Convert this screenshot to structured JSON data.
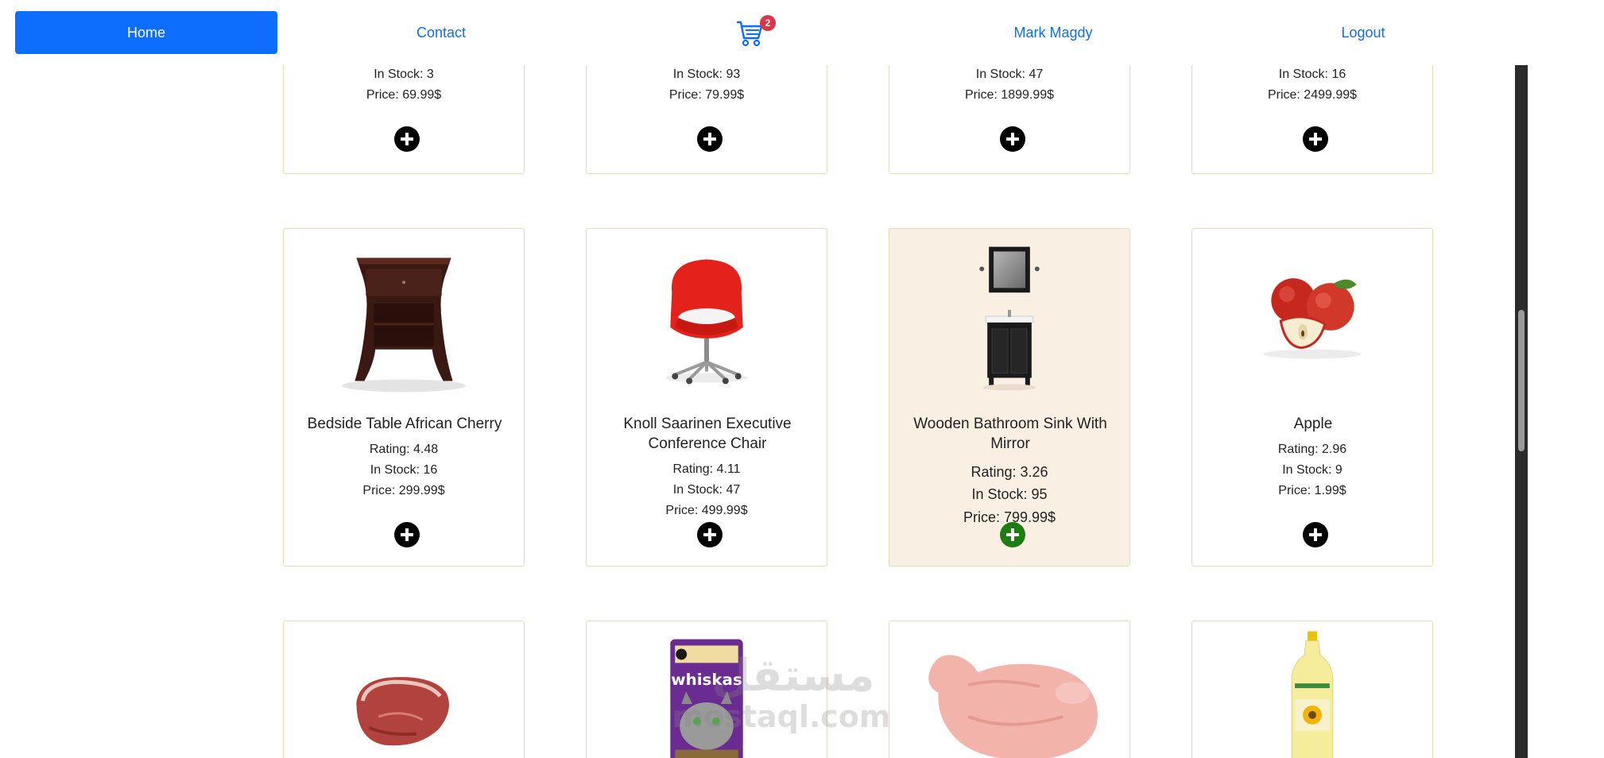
{
  "nav": {
    "home": "Home",
    "contact": "Contact",
    "cart_count": "2",
    "user": "Mark Magdy",
    "logout": "Logout"
  },
  "products_top": [
    {
      "stock": "In Stock: 3",
      "price": "Price: 69.99$"
    },
    {
      "stock": "In Stock: 93",
      "price": "Price: 79.99$"
    },
    {
      "stock": "In Stock: 47",
      "price": "Price: 1899.99$"
    },
    {
      "stock": "In Stock: 16",
      "price": "Price: 2499.99$"
    }
  ],
  "products_mid": [
    {
      "title": "Bedside Table African Cherry",
      "rating": "Rating: 4.48",
      "stock": "In Stock: 16",
      "price": "Price: 299.99$"
    },
    {
      "title": "Knoll Saarinen Executive Conference Chair",
      "rating": "Rating: 4.11",
      "stock": "In Stock: 47",
      "price": "Price: 499.99$"
    },
    {
      "title": "Wooden Bathroom Sink With Mirror",
      "rating": "Rating: 3.26",
      "stock": "In Stock: 95",
      "price": "Price: 799.99$"
    },
    {
      "title": "Apple",
      "rating": "Rating: 2.96",
      "stock": "In Stock: 9",
      "price": "Price: 1.99$"
    }
  ],
  "products_bottom": [
    {
      "image": "steak-image"
    },
    {
      "image": "whiskas-image",
      "brand": "whiskas"
    },
    {
      "image": "chicken-image"
    },
    {
      "image": "oil-bottle-image"
    }
  ],
  "watermark": {
    "text": "mostaql.com",
    "arabic": "مستقل"
  },
  "colors": {
    "primary": "#0d6efd",
    "badge": "#dc3545",
    "card_border": "#e3dcb8",
    "highlight_bg": "#f9efe2",
    "add_green": "#1e7d12"
  }
}
